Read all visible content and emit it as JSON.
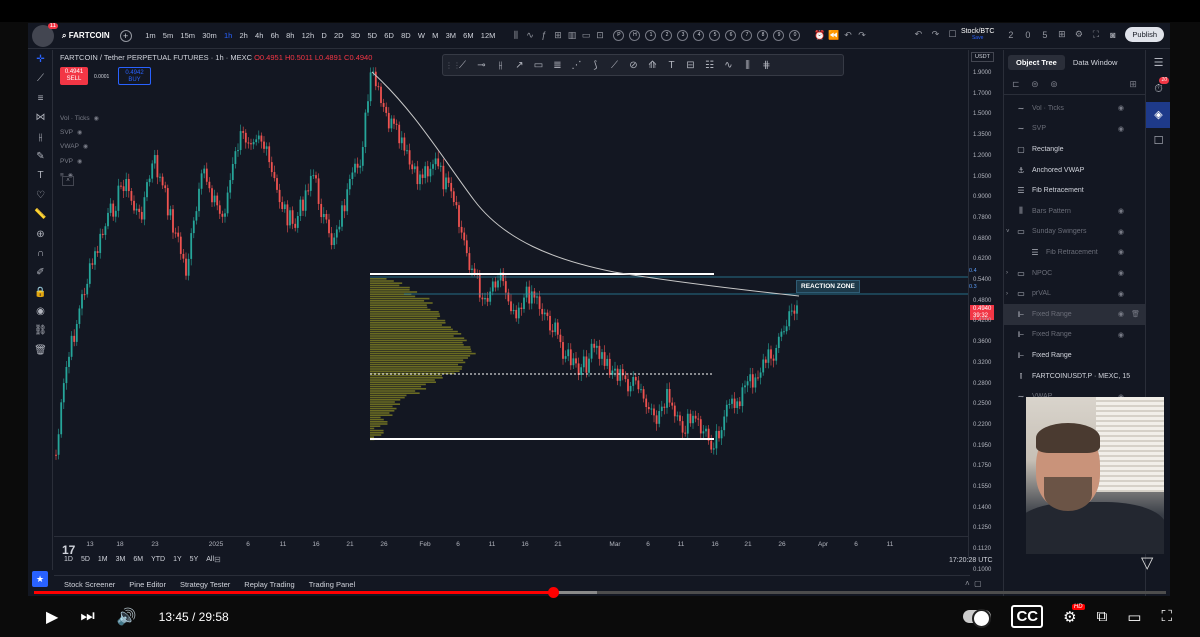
{
  "topbar": {
    "notif_count": "11",
    "symbol": "FARTCOIN",
    "timeframes": [
      "1m",
      "5m",
      "15m",
      "30m",
      "1h",
      "2h",
      "4h",
      "6h",
      "8h",
      "12h",
      "D",
      "2D",
      "3D",
      "5D",
      "6D",
      "8D",
      "W",
      "M",
      "3M",
      "6M",
      "12M"
    ],
    "active_timeframe": "1h",
    "circle_buttons": [
      "P",
      "H",
      "1",
      "2",
      "3",
      "4",
      "5",
      "6",
      "7",
      "8",
      "9",
      "0"
    ],
    "stock_label": "Stock/BTC",
    "stock_sub": "Save",
    "counter1": "2",
    "counter2": "0",
    "counter3": "5",
    "publish_label": "Publish"
  },
  "chart": {
    "legend_title": "FARTCOIN / Tether PERPETUAL FUTURES · 1h · MEXC",
    "legend_ohlc": "O0.4951 H0.5011 L0.4891 C0.4940",
    "sell_price": "0.4941",
    "sell_label": "SELL",
    "spread": "0.0001",
    "buy_price": "0.4942",
    "buy_label": "BUY",
    "indicators": [
      "Vol · Ticks",
      "SVP",
      "VWAP",
      "PVP",
      "≡"
    ],
    "reaction_zone": "REACTION ZONE",
    "tv_logo": "17",
    "currency": "USDT",
    "current_price": "0.4940",
    "current_countdown": "39:32",
    "zone_top_label": "0.4",
    "zone_bottom_label": "0.3",
    "price_ticks": [
      "1.9000",
      "1.7000",
      "1.5000",
      "1.3500",
      "1.2000",
      "1.0500",
      "0.9000",
      "0.7800",
      "0.6800",
      "0.6200",
      "0.5400",
      "0.4800",
      "0.4200",
      "0.3600",
      "0.3200",
      "0.2800",
      "0.2500",
      "0.2200",
      "0.1950",
      "0.1750",
      "0.1550",
      "0.1400",
      "0.1250",
      "0.1120",
      "0.1000"
    ],
    "time_ticks": [
      "13",
      "18",
      "23",
      "2025",
      "6",
      "11",
      "16",
      "21",
      "26",
      "Feb",
      "6",
      "11",
      "16",
      "21",
      "Mar",
      "6",
      "11",
      "16",
      "21",
      "26",
      "Apr",
      "6",
      "11"
    ],
    "clock": "17:20:28 UTC",
    "ranges": [
      "1D",
      "5D",
      "1M",
      "3M",
      "6M",
      "YTD",
      "1Y",
      "5Y",
      "All"
    ]
  },
  "bottom_tabs": [
    "Stock Screener",
    "Pine Editor",
    "Strategy Tester",
    "Replay Trading",
    "Trading Panel"
  ],
  "panel": {
    "tab_object_tree": "Object Tree",
    "tab_data_window": "Data Window",
    "items": [
      {
        "label": "Vol · Ticks",
        "icon": "wave-icon",
        "dim": true,
        "eye": true
      },
      {
        "label": "SVP",
        "icon": "wave-icon",
        "dim": true,
        "eye": true
      },
      {
        "label": "Rectangle",
        "icon": "rectangle-icon",
        "dim": false,
        "eye": false
      },
      {
        "label": "Anchored VWAP",
        "icon": "anchored-vwap-icon",
        "dim": false,
        "eye": false
      },
      {
        "label": "Fib Retracement",
        "icon": "fib-icon",
        "dim": false,
        "eye": false
      },
      {
        "label": "Bars Pattern",
        "icon": "bars-pattern-icon",
        "dim": true,
        "eye": true
      },
      {
        "label": "Sunday Swingers",
        "icon": "folder-icon",
        "dim": true,
        "eye": true,
        "chev": "˅"
      },
      {
        "label": "Fib Retracement",
        "icon": "fib-icon",
        "dim": true,
        "eye": true,
        "indent": true
      },
      {
        "label": "NPOC",
        "icon": "folder-icon",
        "dim": true,
        "eye": true,
        "chev": "›"
      },
      {
        "label": "prVAL",
        "icon": "folder-icon",
        "dim": true,
        "eye": true,
        "chev": "›"
      },
      {
        "label": "Fixed Range",
        "icon": "fixed-range-icon",
        "dim": true,
        "eye": true,
        "selected": true
      },
      {
        "label": "Fixed Range",
        "icon": "fixed-range-icon",
        "dim": true,
        "eye": true
      },
      {
        "label": "Fixed Range",
        "icon": "fixed-range-icon",
        "dim": false,
        "eye": false
      },
      {
        "label": "FARTCOINUSDT.P · MEXC, 15",
        "icon": "candles-icon",
        "dim": false,
        "eye": false
      },
      {
        "label": "VWAP",
        "icon": "wave-icon",
        "dim": true,
        "eye": true
      }
    ]
  },
  "sidebar_right": {
    "alert_count": "10"
  },
  "video": {
    "time": "13:45 / 29:58",
    "progress": 0.459,
    "hd_badge": "HD",
    "cc_label": "CC"
  },
  "colors": {
    "up": "#26a69a",
    "down": "#ef5350",
    "accent": "#2962ff",
    "bg": "#131722",
    "volume_profile": "#7a7a22",
    "vwap": "#c8c8c8"
  }
}
